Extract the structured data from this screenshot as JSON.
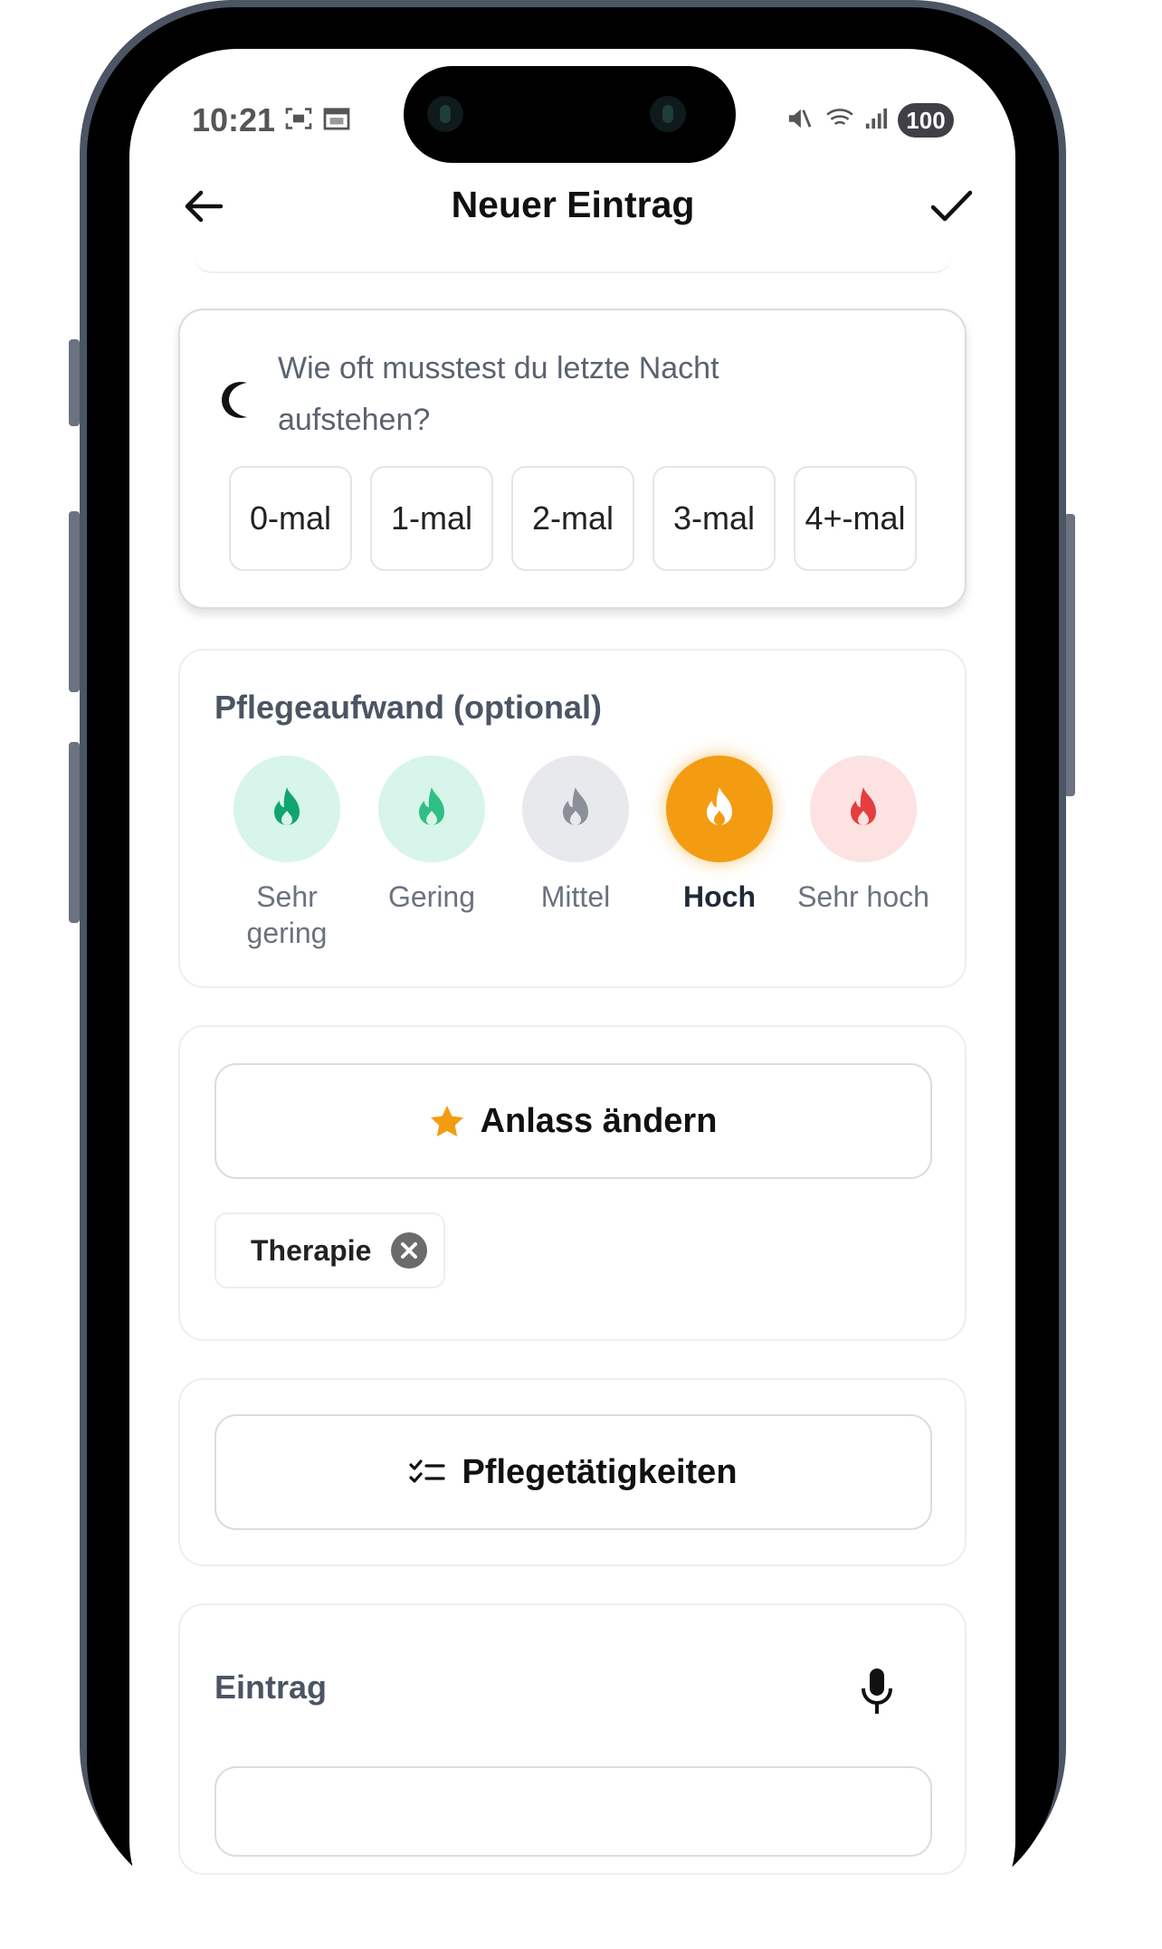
{
  "status_bar": {
    "time": "10:21",
    "battery": "100"
  },
  "header": {
    "title": "Neuer Eintrag"
  },
  "night_question": {
    "question": "Wie oft musstest du letzte Nacht aufstehen?",
    "options": [
      "0-mal",
      "1-mal",
      "2-mal",
      "3-mal",
      "4+-mal"
    ]
  },
  "care_effort": {
    "title": "Pflegeaufwand (optional)",
    "levels": [
      {
        "label": "Sehr gering",
        "bg": "#d7f5ea",
        "fg": "#10a56f",
        "selected": false
      },
      {
        "label": "Gering",
        "bg": "#d7f5ea",
        "fg": "#2fbf84",
        "selected": false
      },
      {
        "label": "Mittel",
        "bg": "#e8e9ec",
        "fg": "#8a8f99",
        "selected": false
      },
      {
        "label": "Hoch",
        "bg": "#f39c12",
        "fg": "#ffffff",
        "selected": true
      },
      {
        "label": "Sehr hoch",
        "bg": "#fde2e2",
        "fg": "#e53e3e",
        "selected": false
      }
    ]
  },
  "occasion": {
    "button_label": "Anlass ändern",
    "chip_label": "Therapie"
  },
  "care_activities": {
    "button_label": "Pflegetätigkeiten"
  },
  "entry": {
    "title": "Eintrag"
  }
}
